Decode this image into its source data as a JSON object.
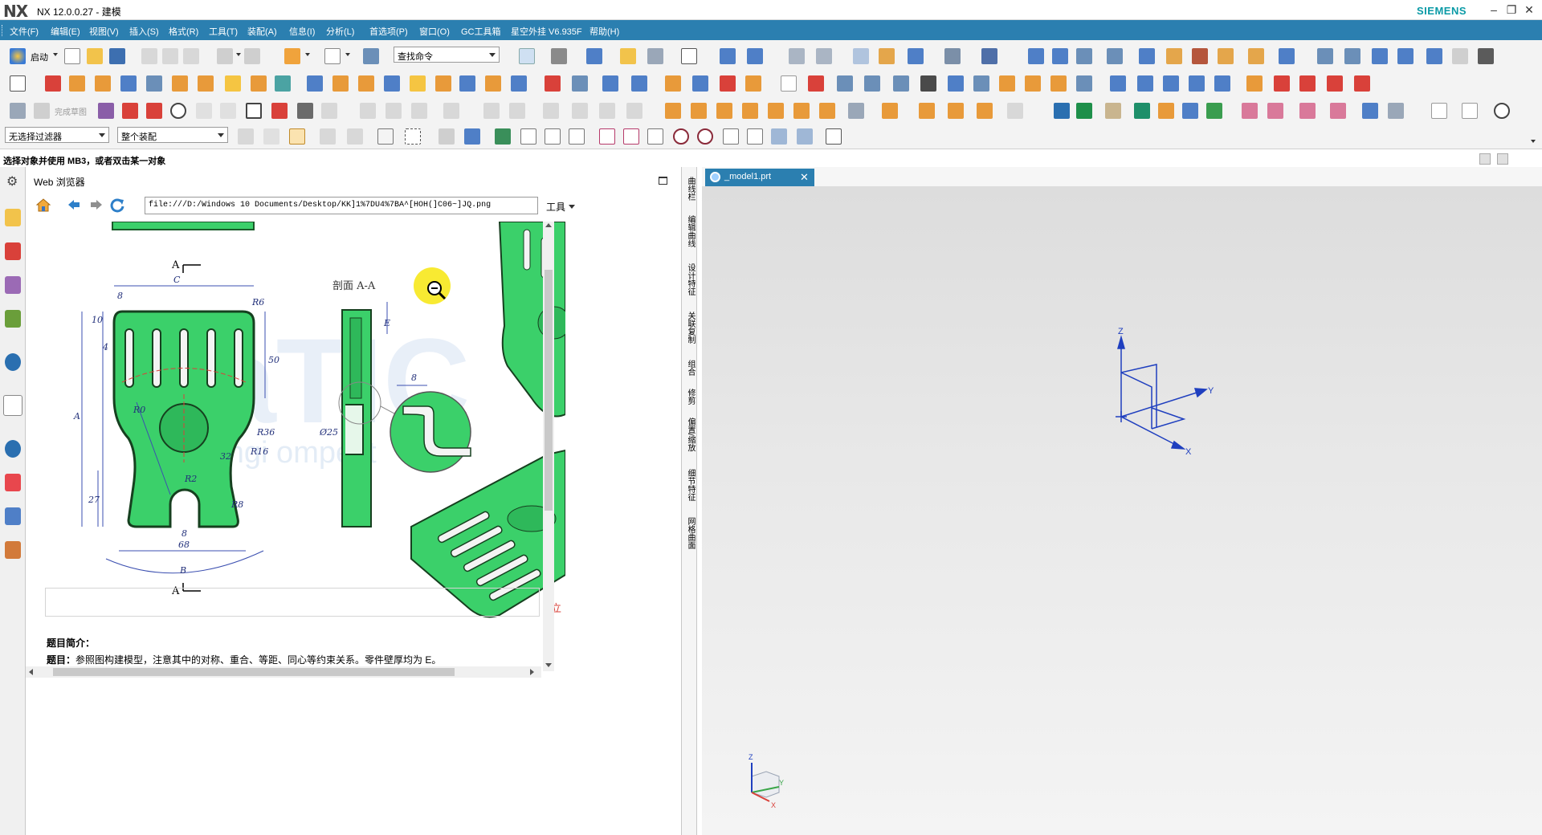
{
  "window": {
    "logo": "NX",
    "title": "NX 12.0.0.27 - 建模",
    "brand": "SIEMENS",
    "minimize": "–",
    "restore": "❐",
    "close": "✕"
  },
  "menubar": {
    "items": [
      "文件(F)",
      "编辑(E)",
      "视图(V)",
      "插入(S)",
      "格式(R)",
      "工具(T)",
      "装配(A)",
      "信息(I)",
      "分析(L)",
      "首选项(P)",
      "窗口(O)",
      "GC工具箱",
      "星空外挂 V6.935F",
      "帮助(H)"
    ]
  },
  "toolbar": {
    "start_label": "启动",
    "find_command_placeholder": "查找命令",
    "selection_filter": "无选择过滤器",
    "assembly_scope": "整个装配",
    "finish_sketch": "完成草图"
  },
  "status_line": "选择对象并使用 MB3，或者双击某一对象",
  "web_browser": {
    "title": "Web 浏览器",
    "url": "file:///D:/Windows 10 Documents/Desktop/KK]1%7DU4%7BA^[HOH(]C06~]JQ.png",
    "tools_label": "工具",
    "drawing": {
      "section_label": "剖面  A-A",
      "section_marker_top": "A",
      "section_marker_bottom": "A",
      "dimensions": [
        "C",
        "8",
        "10",
        "4",
        "R6",
        "50",
        "A",
        "R0",
        "R36",
        "R16",
        "32",
        "Ø25",
        "E",
        "8",
        "R2",
        "R8",
        "27",
        "8",
        "68",
        "B"
      ],
      "watermark": "CaTIC",
      "watermark_sub": "CAD  ngi  ompetit",
      "iso_label": "立"
    },
    "intro_heading": "题目简介：",
    "intro_label": "题目：",
    "intro_text": "参照图构建模型，注意其中的对称、重合、等距、同心等约束关系。零件壁厚均为 E。"
  },
  "resource_bar": {
    "items": [
      "曲线栏",
      "编辑曲线",
      "设计特征",
      "关联复制",
      "组合",
      "修剪",
      "偏置/缩放",
      "细节特征",
      "网格曲面"
    ]
  },
  "graphics": {
    "tab_label": "_model1.prt",
    "tab_close": "✕",
    "axis_z": "Z",
    "axis_y": "Y",
    "axis_x": "X",
    "triad_z": "Z",
    "triad_y": "Y",
    "triad_x": "X"
  }
}
